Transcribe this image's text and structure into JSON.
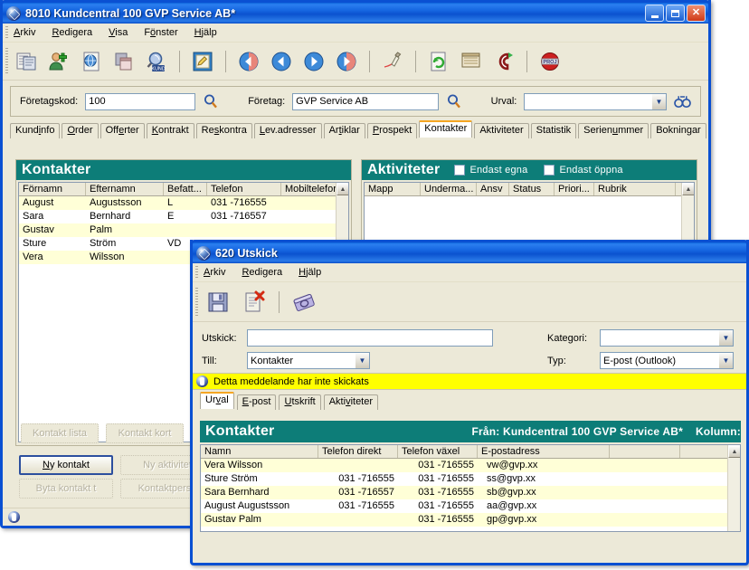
{
  "main_window": {
    "title": "8010 Kundcentral 100 GVP Service AB*",
    "icon": "app-globe-icon",
    "window_buttons": {
      "minimize": "minimize",
      "maximize": "maximize",
      "close": "close"
    },
    "menu": [
      {
        "label": "Arkiv",
        "accel": "A"
      },
      {
        "label": "Redigera",
        "accel": "R"
      },
      {
        "label": "Visa",
        "accel": "V"
      },
      {
        "label": "Fönster",
        "accel": "ö"
      },
      {
        "label": "Hjälp",
        "accel": "H"
      }
    ],
    "toolbar": [
      {
        "name": "new-document-icon"
      },
      {
        "name": "add-customer-icon"
      },
      {
        "name": "web-page-icon"
      },
      {
        "name": "copy-window-icon"
      },
      {
        "name": "search-customer-icon"
      },
      {
        "name": "edit-note-icon"
      },
      {
        "name": "nav-first-icon"
      },
      {
        "name": "nav-previous-icon"
      },
      {
        "name": "nav-next-icon"
      },
      {
        "name": "nav-last-icon"
      },
      {
        "name": "sign-document-icon"
      },
      {
        "name": "refresh-icon"
      },
      {
        "name": "ledger-icon"
      },
      {
        "name": "contract-icon"
      },
      {
        "name": "project-icon"
      }
    ],
    "search_bar": {
      "foretagskod_label": "Företagskod:",
      "foretagskod_value": "100",
      "foretag_label": "Företag:",
      "foretag_value": "GVP Service AB",
      "urval_label": "Urval:",
      "urval_value": "",
      "magnifier_icon": "magnifier-icon",
      "binoculars_icon": "binoculars-icon"
    },
    "tabs": [
      {
        "label": "Kundinfo",
        "selected": false
      },
      {
        "label": "Order",
        "selected": false
      },
      {
        "label": "Offerter",
        "selected": false
      },
      {
        "label": "Kontrakt",
        "selected": false
      },
      {
        "label": "Reskontra",
        "selected": false
      },
      {
        "label": "Lev.adresser",
        "selected": false
      },
      {
        "label": "Artiklar",
        "selected": false
      },
      {
        "label": "Prospekt",
        "selected": false
      },
      {
        "label": "Kontakter",
        "selected": true
      },
      {
        "label": "Aktiviteter",
        "selected": false
      },
      {
        "label": "Statistik",
        "selected": false
      },
      {
        "label": "Serienummer",
        "selected": false
      },
      {
        "label": "Bokningar",
        "selected": false
      }
    ],
    "kontakter_panel": {
      "title": "Kontakter",
      "columns": [
        "Förnamn",
        "Efternamn",
        "Befatt...",
        "Telefon",
        "Mobiltelefor"
      ],
      "rows": [
        [
          "August",
          "Augustsson",
          "L",
          "031 -716555",
          ""
        ],
        [
          "Sara",
          "Bernhard",
          "E",
          "031 -716557",
          ""
        ],
        [
          "Gustav",
          "Palm",
          "",
          "",
          ""
        ],
        [
          "Sture",
          "Ström",
          "VD",
          "",
          ""
        ],
        [
          "Vera",
          "Wilsson",
          "",
          "",
          ""
        ]
      ]
    },
    "aktiviteter_panel": {
      "title": "Aktiviteter",
      "checkbox_egna": "Endast egna",
      "checkbox_oppna": "Endast öppna",
      "columns": [
        "Mapp",
        "Underma...",
        "Ansv",
        "Status",
        "Priori...",
        "Rubrik"
      ],
      "rows": []
    },
    "buttons": [
      {
        "label": "Kontakt lista",
        "enabled": false
      },
      {
        "label": "Kontakt kort",
        "enabled": false
      },
      {
        "label": "Ny kontakt",
        "enabled": true,
        "default": true,
        "accel": "N"
      },
      {
        "label": "Ny aktivitet",
        "enabled": false
      },
      {
        "label": "Byta kontakt t",
        "enabled": false
      },
      {
        "label": "Kontaktperso",
        "enabled": false
      }
    ]
  },
  "utskick_window": {
    "title": "620 Utskick",
    "icon": "app-globe-icon",
    "menu": [
      {
        "label": "Arkiv",
        "accel": "A"
      },
      {
        "label": "Redigera",
        "accel": "R"
      },
      {
        "label": "Hjälp",
        "accel": "H"
      }
    ],
    "toolbar": [
      {
        "name": "save-icon"
      },
      {
        "name": "delete-document-icon"
      },
      {
        "name": "address-book-icon"
      }
    ],
    "form": {
      "utskick_label": "Utskick:",
      "utskick_value": "",
      "till_label": "Till:",
      "till_value": "Kontakter",
      "kategori_label": "Kategori:",
      "kategori_value": "",
      "typ_label": "Typ:",
      "typ_value": "E-post (Outlook)"
    },
    "warning": {
      "icon": "info-icon",
      "text": "Detta meddelande har inte skickats"
    },
    "tabs": [
      {
        "label": "Urval",
        "selected": true
      },
      {
        "label": "E-post",
        "selected": false
      },
      {
        "label": "Utskrift",
        "selected": false
      },
      {
        "label": "Aktiviteter",
        "selected": false
      }
    ],
    "result_panel": {
      "title": "Kontakter",
      "from_label": "Från: Kundcentral 100 GVP Service AB*",
      "kolumn_label": "Kolumn:",
      "columns": [
        "Namn",
        "Telefon direkt",
        "Telefon växel",
        "E-postadress",
        "",
        ""
      ],
      "rows": [
        [
          "Vera Wilsson",
          "",
          "031 -716555",
          "vw@gvp.xx",
          "",
          ""
        ],
        [
          "Sture Ström",
          "031 -716555",
          "031 -716555",
          "ss@gvp.xx",
          "",
          ""
        ],
        [
          "Sara Bernhard",
          "031 -716557",
          "031 -716555",
          "sb@gvp.xx",
          "",
          ""
        ],
        [
          "August Augustsson",
          "031 -716555",
          "031 -716555",
          "aa@gvp.xx",
          "",
          ""
        ],
        [
          "Gustav Palm",
          "",
          "031 -716555",
          "gp@gvp.xx",
          "",
          ""
        ]
      ]
    }
  },
  "colors": {
    "title_blue": "#0a50d2",
    "panel_teal": "#0d7d78",
    "face": "#ece9d8",
    "row_alt": "#ffffd7",
    "warn_yellow": "#ffff00",
    "tab_accent": "#f5a623"
  }
}
